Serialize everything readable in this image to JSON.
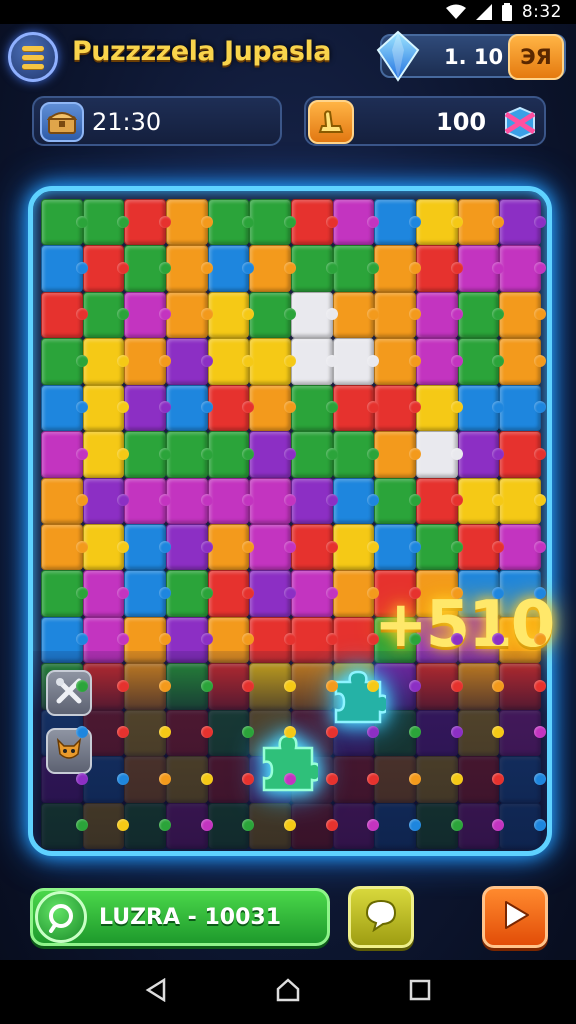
{
  "status_bar": {
    "time": "8:32",
    "wifi_icon": "wifi-icon",
    "signal_icon": "signal-icon",
    "battery_icon": "battery-icon"
  },
  "header": {
    "menu_icon": "hamburger-menu-icon",
    "title": "Puzzzzela Jupasla",
    "gems": {
      "icon": "blue-gem-icon",
      "count": "1. 10",
      "add_label": "ЭЯ"
    }
  },
  "stats": {
    "timer": {
      "icon": "treasure-chest-icon",
      "value": "21:30"
    },
    "moves": {
      "icon": "golden-hand-icon",
      "value": "100",
      "secondary_icon": "gift-box-icon"
    }
  },
  "board": {
    "columns": 12,
    "rows": 14,
    "palette": [
      "#e6322e",
      "#f39a1c",
      "#f5c916",
      "#2ba43a",
      "#1e86de",
      "#8c2fc4",
      "#c334c0",
      "#e9e9ee"
    ],
    "score_popup": "+510",
    "side_tools": [
      "crossed-tools-icon",
      "fox-helper-icon"
    ],
    "floating_pieces": [
      "teal-puzzle-piece-icon",
      "green-puzzle-piece-icon"
    ]
  },
  "footer": {
    "level_icon": "green-ring-icon",
    "level_label": "LUZRA - 10031",
    "hint_icon": "speech-bubble-icon",
    "play_icon": "play-arrow-icon"
  },
  "navbar": {
    "back_icon": "back-triangle-icon",
    "home_icon": "home-icon",
    "recents_icon": "recents-square-icon"
  },
  "colors": {
    "accent": "#5fd2ff",
    "title": "#f9d44c",
    "score": "#ffe86a"
  }
}
